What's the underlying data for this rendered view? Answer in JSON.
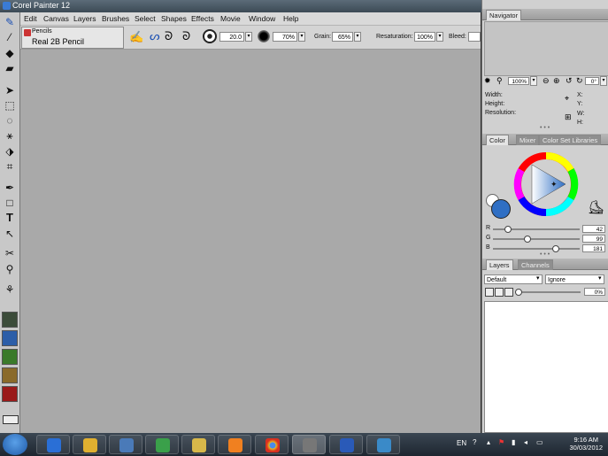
{
  "window": {
    "title": "Corel Painter 12"
  },
  "menu": [
    "Edit",
    "Canvas",
    "Layers",
    "Brushes",
    "Select",
    "Shapes",
    "Effects",
    "Movie",
    "Window",
    "Help"
  ],
  "property_bar": {
    "brush_category": "Pencils",
    "brush_variant": "Real 2B Pencil",
    "size_value": "20.0",
    "opacity_value": "70%",
    "grain_label": "Grain:",
    "grain_value": "65%",
    "resaturation_label": "Resaturation:",
    "resaturation_value": "100%",
    "bleed_label": "Bleed:"
  },
  "navigator": {
    "title": "Navigator",
    "zoom_value": "100%",
    "rotation_value": "0°",
    "width_label": "Width:",
    "height_label": "Height:",
    "resolution_label": "Resolution:",
    "x_label": "X:",
    "y_label": "Y:",
    "w_label": "W:",
    "h_label": "H:"
  },
  "color_panel": {
    "tabs": [
      "Color",
      "Mixer",
      "Color Set Libraries"
    ],
    "main_color": "#2f6fc4",
    "r_label": "R",
    "r_value": "42",
    "r_fraction": 0.165,
    "g_label": "G",
    "g_value": "99",
    "g_fraction": 0.388,
    "b_label": "B",
    "b_value": "181",
    "b_fraction": 0.71
  },
  "layers_panel": {
    "tabs": [
      "Layers",
      "Channels"
    ],
    "composite_method": "Default",
    "composite_depth": "Ignore",
    "opacity_value": "0%"
  },
  "taskbar": {
    "language": "EN",
    "time": "9:16 AM",
    "date": "30/03/2012"
  }
}
